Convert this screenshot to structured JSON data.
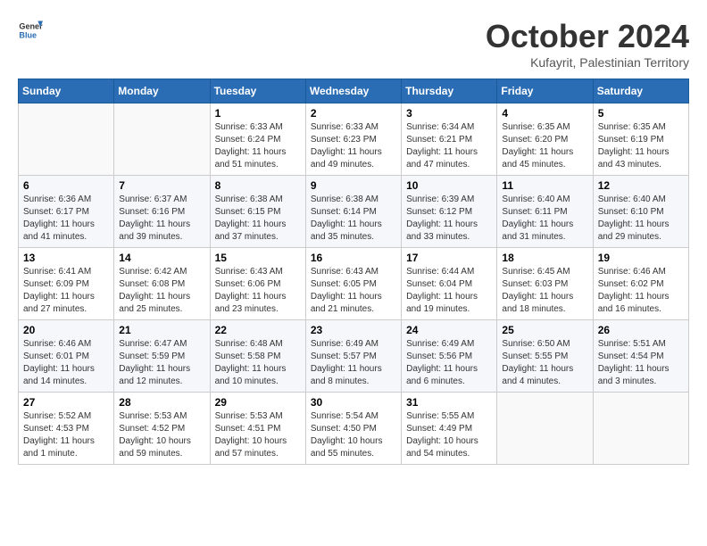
{
  "logo": {
    "line1": "General",
    "line2": "Blue"
  },
  "title": "October 2024",
  "location": "Kufayrit, Palestinian Territory",
  "days_header": [
    "Sunday",
    "Monday",
    "Tuesday",
    "Wednesday",
    "Thursday",
    "Friday",
    "Saturday"
  ],
  "weeks": [
    [
      {
        "day": "",
        "content": ""
      },
      {
        "day": "",
        "content": ""
      },
      {
        "day": "1",
        "content": "Sunrise: 6:33 AM\nSunset: 6:24 PM\nDaylight: 11 hours and 51 minutes."
      },
      {
        "day": "2",
        "content": "Sunrise: 6:33 AM\nSunset: 6:23 PM\nDaylight: 11 hours and 49 minutes."
      },
      {
        "day": "3",
        "content": "Sunrise: 6:34 AM\nSunset: 6:21 PM\nDaylight: 11 hours and 47 minutes."
      },
      {
        "day": "4",
        "content": "Sunrise: 6:35 AM\nSunset: 6:20 PM\nDaylight: 11 hours and 45 minutes."
      },
      {
        "day": "5",
        "content": "Sunrise: 6:35 AM\nSunset: 6:19 PM\nDaylight: 11 hours and 43 minutes."
      }
    ],
    [
      {
        "day": "6",
        "content": "Sunrise: 6:36 AM\nSunset: 6:17 PM\nDaylight: 11 hours and 41 minutes."
      },
      {
        "day": "7",
        "content": "Sunrise: 6:37 AM\nSunset: 6:16 PM\nDaylight: 11 hours and 39 minutes."
      },
      {
        "day": "8",
        "content": "Sunrise: 6:38 AM\nSunset: 6:15 PM\nDaylight: 11 hours and 37 minutes."
      },
      {
        "day": "9",
        "content": "Sunrise: 6:38 AM\nSunset: 6:14 PM\nDaylight: 11 hours and 35 minutes."
      },
      {
        "day": "10",
        "content": "Sunrise: 6:39 AM\nSunset: 6:12 PM\nDaylight: 11 hours and 33 minutes."
      },
      {
        "day": "11",
        "content": "Sunrise: 6:40 AM\nSunset: 6:11 PM\nDaylight: 11 hours and 31 minutes."
      },
      {
        "day": "12",
        "content": "Sunrise: 6:40 AM\nSunset: 6:10 PM\nDaylight: 11 hours and 29 minutes."
      }
    ],
    [
      {
        "day": "13",
        "content": "Sunrise: 6:41 AM\nSunset: 6:09 PM\nDaylight: 11 hours and 27 minutes."
      },
      {
        "day": "14",
        "content": "Sunrise: 6:42 AM\nSunset: 6:08 PM\nDaylight: 11 hours and 25 minutes."
      },
      {
        "day": "15",
        "content": "Sunrise: 6:43 AM\nSunset: 6:06 PM\nDaylight: 11 hours and 23 minutes."
      },
      {
        "day": "16",
        "content": "Sunrise: 6:43 AM\nSunset: 6:05 PM\nDaylight: 11 hours and 21 minutes."
      },
      {
        "day": "17",
        "content": "Sunrise: 6:44 AM\nSunset: 6:04 PM\nDaylight: 11 hours and 19 minutes."
      },
      {
        "day": "18",
        "content": "Sunrise: 6:45 AM\nSunset: 6:03 PM\nDaylight: 11 hours and 18 minutes."
      },
      {
        "day": "19",
        "content": "Sunrise: 6:46 AM\nSunset: 6:02 PM\nDaylight: 11 hours and 16 minutes."
      }
    ],
    [
      {
        "day": "20",
        "content": "Sunrise: 6:46 AM\nSunset: 6:01 PM\nDaylight: 11 hours and 14 minutes."
      },
      {
        "day": "21",
        "content": "Sunrise: 6:47 AM\nSunset: 5:59 PM\nDaylight: 11 hours and 12 minutes."
      },
      {
        "day": "22",
        "content": "Sunrise: 6:48 AM\nSunset: 5:58 PM\nDaylight: 11 hours and 10 minutes."
      },
      {
        "day": "23",
        "content": "Sunrise: 6:49 AM\nSunset: 5:57 PM\nDaylight: 11 hours and 8 minutes."
      },
      {
        "day": "24",
        "content": "Sunrise: 6:49 AM\nSunset: 5:56 PM\nDaylight: 11 hours and 6 minutes."
      },
      {
        "day": "25",
        "content": "Sunrise: 6:50 AM\nSunset: 5:55 PM\nDaylight: 11 hours and 4 minutes."
      },
      {
        "day": "26",
        "content": "Sunrise: 5:51 AM\nSunset: 4:54 PM\nDaylight: 11 hours and 3 minutes."
      }
    ],
    [
      {
        "day": "27",
        "content": "Sunrise: 5:52 AM\nSunset: 4:53 PM\nDaylight: 11 hours and 1 minute."
      },
      {
        "day": "28",
        "content": "Sunrise: 5:53 AM\nSunset: 4:52 PM\nDaylight: 10 hours and 59 minutes."
      },
      {
        "day": "29",
        "content": "Sunrise: 5:53 AM\nSunset: 4:51 PM\nDaylight: 10 hours and 57 minutes."
      },
      {
        "day": "30",
        "content": "Sunrise: 5:54 AM\nSunset: 4:50 PM\nDaylight: 10 hours and 55 minutes."
      },
      {
        "day": "31",
        "content": "Sunrise: 5:55 AM\nSunset: 4:49 PM\nDaylight: 10 hours and 54 minutes."
      },
      {
        "day": "",
        "content": ""
      },
      {
        "day": "",
        "content": ""
      }
    ]
  ]
}
